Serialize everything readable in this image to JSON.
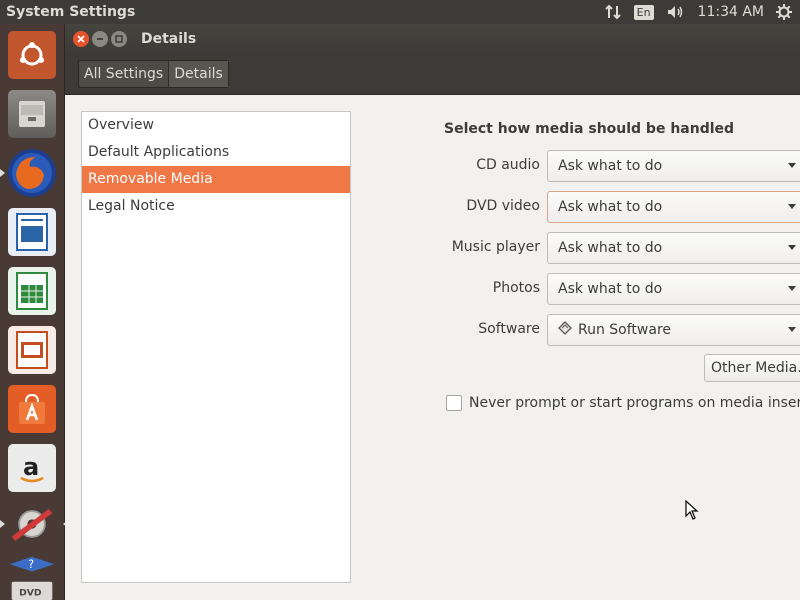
{
  "top_panel": {
    "title": "System Settings",
    "keyboard_layout": "En",
    "clock": "11:34 AM"
  },
  "launcher": {
    "items": [
      {
        "name": "ubuntu-dash",
        "color": "#c2562d"
      },
      {
        "name": "files",
        "color": "#6e6e6a"
      },
      {
        "name": "firefox",
        "color": "#e36a1f"
      },
      {
        "name": "libreoffice-writer",
        "color": "#2a64a6"
      },
      {
        "name": "libreoffice-calc",
        "color": "#2e8a3c"
      },
      {
        "name": "libreoffice-impress",
        "color": "#c24d1e"
      },
      {
        "name": "ubuntu-software",
        "color": "#e45d26"
      },
      {
        "name": "amazon",
        "color": "#e9e9e9"
      },
      {
        "name": "system-settings",
        "color": "#d03a3a"
      },
      {
        "name": "dvd",
        "color": "#5a5855"
      }
    ]
  },
  "window": {
    "title": "Details",
    "breadcrumbs": [
      "All Settings",
      "Details"
    ]
  },
  "sidebar": {
    "items": [
      {
        "label": "Overview"
      },
      {
        "label": "Default Applications"
      },
      {
        "label": "Removable Media"
      },
      {
        "label": "Legal Notice"
      }
    ],
    "selected": "Removable Media"
  },
  "media": {
    "heading": "Select how media should be handled",
    "rows": [
      {
        "label": "CD audio",
        "value": "Ask what to do"
      },
      {
        "label": "DVD video",
        "value": "Ask what to do"
      },
      {
        "label": "Music player",
        "value": "Ask what to do"
      },
      {
        "label": "Photos",
        "value": "Ask what to do"
      },
      {
        "label": "Software",
        "value": "Run Software"
      }
    ],
    "other_button": "Other Media...",
    "never_prompt_label": "Never prompt or start programs on media insertion",
    "never_prompt_checked": false
  },
  "colors": {
    "accent": "#f07746",
    "panel": "#3c3b37",
    "launcher": "#4a3a36"
  }
}
